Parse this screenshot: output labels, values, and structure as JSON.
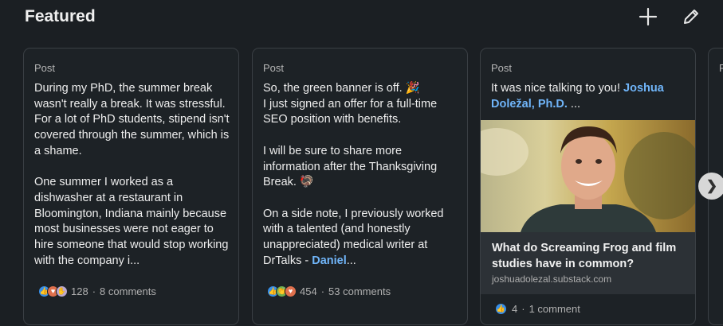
{
  "header": {
    "title": "Featured",
    "add_icon": "plus-icon",
    "edit_icon": "pencil-icon"
  },
  "cards": [
    {
      "type": "Post",
      "text": "During my PhD, the summer break wasn't really a break. It was stressful. For a lot of PhD students, stipend isn't covered through the summer, which is a shame.\n\nOne summer I worked as a dishwasher at a restaurant in Bloomington, Indiana mainly because most businesses were not eager to hire someone that would stop working with the company i...",
      "reactions": [
        "like",
        "love",
        "support"
      ],
      "reaction_count": "128",
      "separator": "·",
      "comments": "8 comments"
    },
    {
      "type": "Post",
      "text_main": "So, the green banner is off. 🎉\nI just signed an offer for a full-time SEO position with benefits.\n\nI will be sure to share more information after the Thanksgiving Break. 🦃\n\nOn a side note, I previously worked with a talented (and honestly unappreciated) medical writer at DrTalks - ",
      "text_link": "Daniel",
      "text_tail": "...",
      "reactions": [
        "like",
        "celebrate",
        "love"
      ],
      "reaction_count": "454",
      "separator": "·",
      "comments": "53 comments"
    },
    {
      "type": "Post",
      "text_main": "It was nice talking to you! ",
      "text_link": "Joshua Doležal, Ph.D.",
      "text_tail": " ...",
      "article_title": "What do Screaming Frog and film studies have in common?",
      "article_source": "joshuadolezal.substack.com",
      "reactions": [
        "like"
      ],
      "reaction_count": "4",
      "separator": "·",
      "comments": "1 comment"
    },
    {
      "type": "P"
    }
  ],
  "next_button": "❯"
}
